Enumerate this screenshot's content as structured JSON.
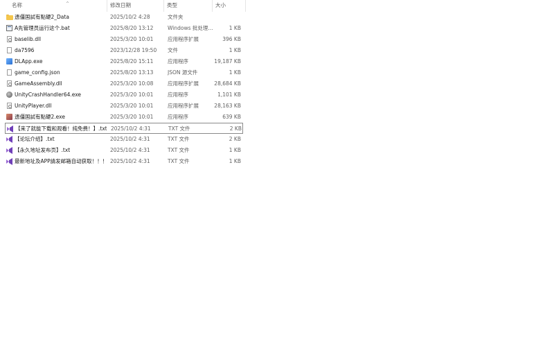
{
  "columns": {
    "name": "名称",
    "date": "修改日期",
    "type": "类型",
    "size": "大小"
  },
  "sort_indicator": "^",
  "files": [
    {
      "name": "遗僵国試有點硬2_Data",
      "date": "2025/10/2 4:28",
      "type": "文件夹",
      "size": "",
      "icon": "folder-icon"
    },
    {
      "name": "A先管理员运行这个.bat",
      "date": "2025/8/20 13:12",
      "type": "Windows 批处理...",
      "size": "1 KB",
      "icon": "batch-file-icon"
    },
    {
      "name": "baselib.dll",
      "date": "2025/3/20 10:01",
      "type": "应用程序扩展",
      "size": "396 KB",
      "icon": "dll-file-icon"
    },
    {
      "name": "da7596",
      "date": "2023/12/28 19:50",
      "type": "文件",
      "size": "1 KB",
      "icon": "file-icon"
    },
    {
      "name": "DLApp.exe",
      "date": "2025/8/20 15:11",
      "type": "应用程序",
      "size": "19,187 KB",
      "icon": "app-icon"
    },
    {
      "name": "game_config.json",
      "date": "2025/8/20 13:13",
      "type": "JSON 源文件",
      "size": "1 KB",
      "icon": "json-file-icon"
    },
    {
      "name": "GameAssembly.dll",
      "date": "2025/3/20 10:08",
      "type": "应用程序扩展",
      "size": "28,684 KB",
      "icon": "dll-file-icon"
    },
    {
      "name": "UnityCrashHandler64.exe",
      "date": "2025/3/20 10:01",
      "type": "应用程序",
      "size": "1,101 KB",
      "icon": "unity-icon"
    },
    {
      "name": "UnityPlayer.dll",
      "date": "2025/3/20 10:01",
      "type": "应用程序扩展",
      "size": "28,163 KB",
      "icon": "dll-file-icon"
    },
    {
      "name": "遗僵国試有點硬2.exe",
      "date": "2025/3/20 10:01",
      "type": "应用程序",
      "size": "639 KB",
      "icon": "game-app-icon"
    },
    {
      "name": "【来了就能下载和观看！纯免费！】.txt",
      "date": "2025/10/2 4:31",
      "type": "TXT 文件",
      "size": "2 KB",
      "icon": "vs-text-icon",
      "selected": true
    },
    {
      "name": "【论坛介绍】.txt",
      "date": "2025/10/2 4:31",
      "type": "TXT 文件",
      "size": "2 KB",
      "icon": "vs-text-icon"
    },
    {
      "name": "【永久地址发布页】.txt",
      "date": "2025/10/2 4:31",
      "type": "TXT 文件",
      "size": "1 KB",
      "icon": "vs-text-icon"
    },
    {
      "name": "最新地址及APP請发邮箱自动获取！！！...",
      "date": "2025/10/2 4:31",
      "type": "TXT 文件",
      "size": "1 KB",
      "icon": "vs-text-icon"
    }
  ]
}
